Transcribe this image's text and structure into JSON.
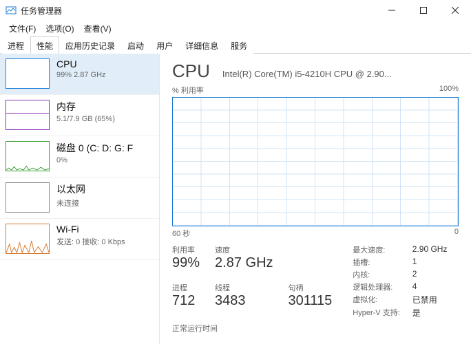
{
  "window": {
    "title": "任务管理器"
  },
  "menu": {
    "file": "文件(F)",
    "options": "选项(O)",
    "view": "查看(V)"
  },
  "tabs": {
    "processes": "进程",
    "performance": "性能",
    "app_history": "应用历史记录",
    "startup": "启动",
    "users": "用户",
    "details": "详细信息",
    "services": "服务"
  },
  "sidebar": {
    "cpu": {
      "title": "CPU",
      "sub": "99%  2.87 GHz"
    },
    "mem": {
      "title": "内存",
      "sub": "5.1/7.9 GB (65%)"
    },
    "disk": {
      "title": "磁盘 0 (C: D: G: F",
      "sub": "0%"
    },
    "eth": {
      "title": "以太网",
      "sub": "未连接"
    },
    "wifi": {
      "title": "Wi-Fi",
      "sub": "发送: 0 接收: 0 Kbps"
    }
  },
  "main": {
    "title": "CPU",
    "model": "Intel(R) Core(TM) i5-4210H CPU @ 2.90...",
    "util_label": "% 利用率",
    "util_max": "100%",
    "x_left": "60 秒",
    "x_right": "0",
    "stats": {
      "util_lbl": "利用率",
      "util_val": "99%",
      "speed_lbl": "速度",
      "speed_val": "2.87 GHz",
      "proc_lbl": "进程",
      "proc_val": "712",
      "thread_lbl": "线程",
      "thread_val": "3483",
      "handle_lbl": "句柄",
      "handle_val": "301115",
      "uptime_lbl": "正常运行时间"
    },
    "right": {
      "maxspeed_lbl": "最大速度:",
      "maxspeed_val": "2.90 GHz",
      "sockets_lbl": "插槽:",
      "sockets_val": "1",
      "cores_lbl": "内核:",
      "cores_val": "2",
      "logical_lbl": "逻辑处理器:",
      "logical_val": "4",
      "virt_lbl": "虚拟化:",
      "virt_val": "已禁用",
      "hyperv_lbl": "Hyper-V 支持:",
      "hyperv_val": "是"
    }
  },
  "chart_data": {
    "type": "line",
    "title": "CPU % 利用率",
    "xlabel": "秒",
    "ylabel": "% 利用率",
    "ylim": [
      0,
      100
    ],
    "xlim": [
      60,
      0
    ],
    "series": [
      {
        "name": "CPU",
        "values": []
      }
    ]
  }
}
